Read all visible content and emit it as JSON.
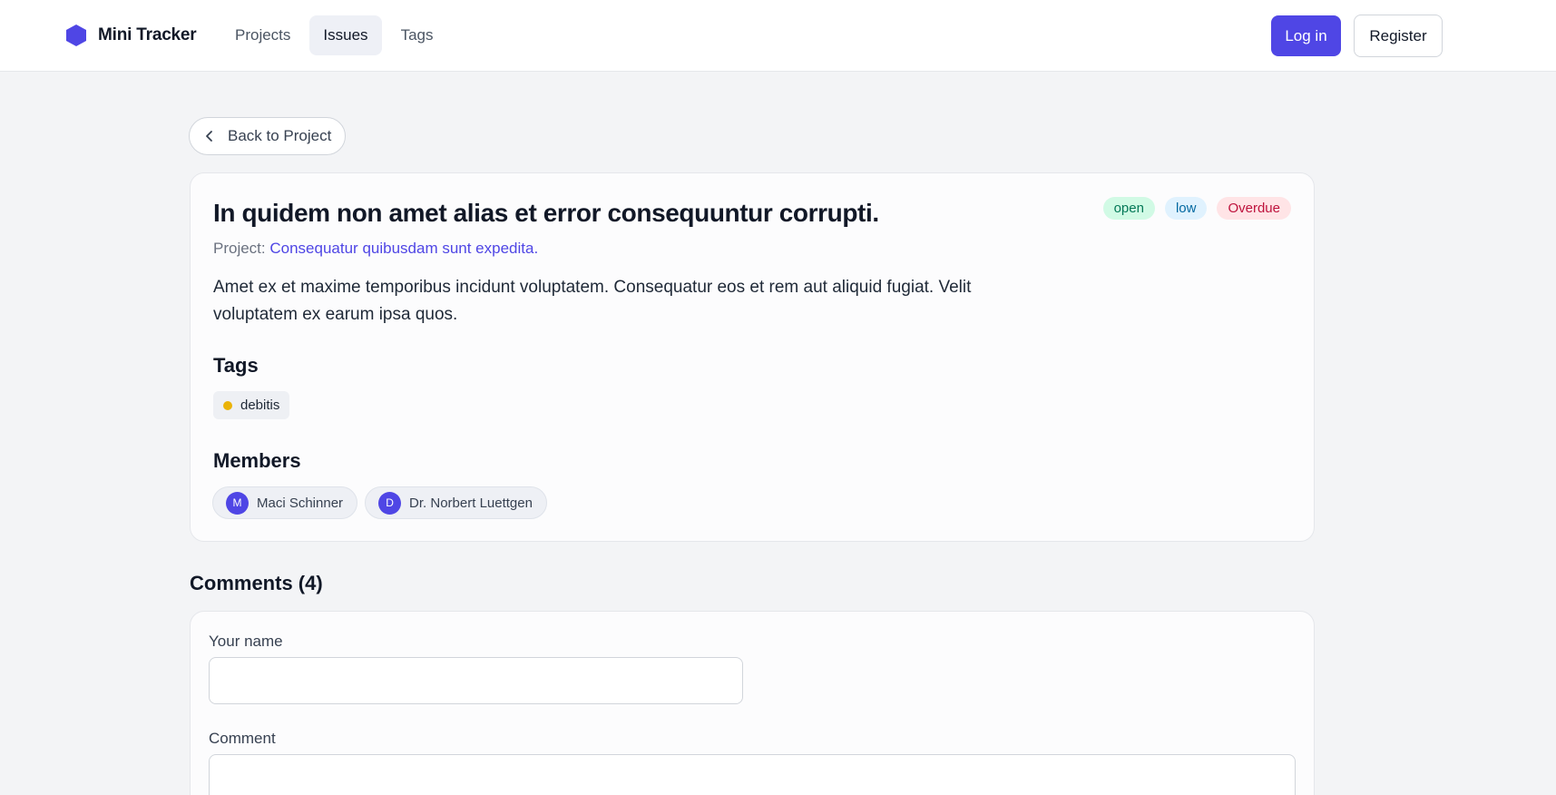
{
  "header": {
    "brand_name": "Mini Tracker",
    "brand_color": "#4f46e5",
    "nav": [
      {
        "label": "Projects",
        "active": false
      },
      {
        "label": "Issues",
        "active": true
      },
      {
        "label": "Tags",
        "active": false
      }
    ],
    "login_label": "Log in",
    "register_label": "Register"
  },
  "back_label": "Back to Project",
  "issue": {
    "title": "In quidem non amet alias et error consequuntur corrupti.",
    "badges": {
      "status": "open",
      "priority": "low",
      "due": "Overdue"
    },
    "project_prefix": "Project:",
    "project_name": "Consequatur quibusdam sunt expedita.",
    "description": "Amet ex et maxime temporibus incidunt voluptatem. Consequatur eos et rem aut aliquid fugiat. Velit voluptatem ex earum ipsa quos.",
    "tags_title": "Tags",
    "tags": [
      {
        "name": "debitis",
        "color": "#eab308"
      }
    ],
    "members_title": "Members",
    "members": [
      {
        "initial": "M",
        "name": "Maci Schinner"
      },
      {
        "initial": "D",
        "name": "Dr. Norbert Luettgen"
      }
    ]
  },
  "comments": {
    "title": "Comments (4)",
    "name_label": "Your name",
    "name_value": "",
    "comment_label": "Comment",
    "comment_value": ""
  }
}
